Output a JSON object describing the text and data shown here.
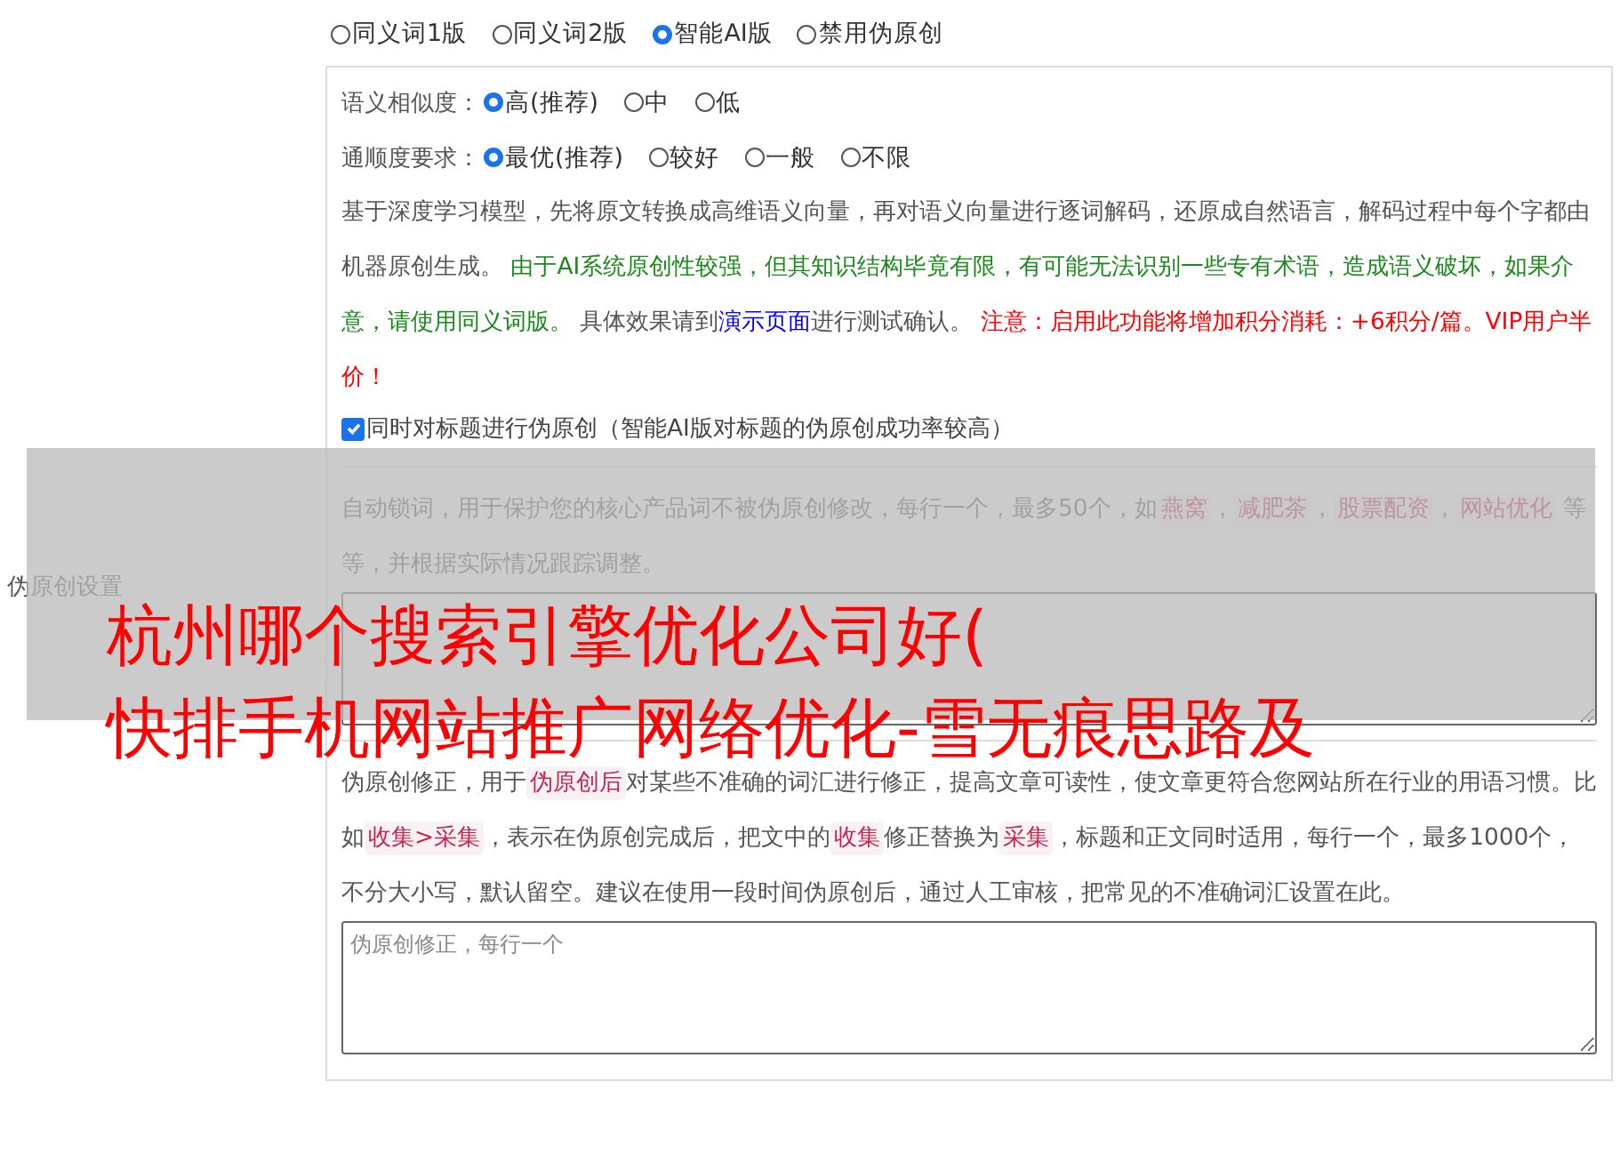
{
  "modes": [
    {
      "label": "同义词1版",
      "selected": false
    },
    {
      "label": "同义词2版",
      "selected": false
    },
    {
      "label": "智能AI版",
      "selected": true
    },
    {
      "label": "禁用伪原创",
      "selected": false
    }
  ],
  "side_label": "伪原创设置",
  "similarity": {
    "label": "语义相似度：",
    "options": [
      {
        "label": "高(推荐)",
        "selected": true
      },
      {
        "label": "中",
        "selected": false
      },
      {
        "label": "低",
        "selected": false
      }
    ]
  },
  "fluency": {
    "label": "通顺度要求：",
    "options": [
      {
        "label": "最优(推荐)",
        "selected": true
      },
      {
        "label": "较好",
        "selected": false
      },
      {
        "label": "一般",
        "selected": false
      },
      {
        "label": "不限",
        "selected": false
      }
    ]
  },
  "description": [
    {
      "kind": "plain",
      "text": "基于深度学习模型，先将原文转换成高维语义向量，再对语义向量进行逐词解码，还原成自然语言，解码过程中每个字都由机器原创生成。 "
    },
    {
      "kind": "green",
      "text": "由于AI系统原创性较强，但其知识结构毕竟有限，有可能无法识别一些专有术语，造成语义破坏，如果介意，请使用同义词版。"
    },
    {
      "kind": "plain",
      "text": " 具体效果请到"
    },
    {
      "kind": "link",
      "text": "演示页面"
    },
    {
      "kind": "plain",
      "text": "进行测试确认。 "
    },
    {
      "kind": "red",
      "text": "注意：启用此功能将增加积分消耗：+6积分/篇。VIP用户半价！"
    }
  ],
  "title_option": {
    "label": "同时对标题进行伪原创（智能AI版对标题的伪原创成功率较高）",
    "checked": true
  },
  "lock_words": {
    "description": [
      {
        "kind": "plain",
        "text": "自动锁词，用于保护您的核心产品词不被伪原创修改，每行一个，最多50个，如"
      },
      {
        "kind": "tag",
        "text": "燕窝"
      },
      {
        "kind": "plain",
        "text": "，"
      },
      {
        "kind": "tag",
        "text": "减肥茶"
      },
      {
        "kind": "plain",
        "text": "，"
      },
      {
        "kind": "tag",
        "text": "股票配资"
      },
      {
        "kind": "plain",
        "text": "，"
      },
      {
        "kind": "tag",
        "text": "网站优化"
      },
      {
        "kind": "plain",
        "text": " 等等，并根据实际情况跟踪调整。"
      }
    ]
  },
  "corrections": {
    "description": [
      {
        "kind": "plain",
        "text": "伪原创修正，用于"
      },
      {
        "kind": "tag",
        "text": "伪原创后"
      },
      {
        "kind": "plain",
        "text": "对某些不准确的词汇进行修正，提高文章可读性，使文章更符合您网站所在行业的用语习惯。比如"
      },
      {
        "kind": "tag",
        "text": "收集>采集"
      },
      {
        "kind": "plain",
        "text": "，表示在伪原创完成后，把文中的"
      },
      {
        "kind": "tag",
        "text": "收集"
      },
      {
        "kind": "plain",
        "text": "修正替换为"
      },
      {
        "kind": "tag",
        "text": "采集"
      },
      {
        "kind": "plain",
        "text": "，标题和正文同时适用，每行一个，最多1000个，不分大小写，默认留空。建议在使用一段时间伪原创后，通过人工审核，把常见的不准确词汇设置在此。"
      }
    ],
    "placeholder": "伪原创修正，每行一个"
  },
  "overlay_caption": [
    "杭州哪个搜索引擎优化公司好(",
    "快排手机网站推广网络优化-雪无痕思路及"
  ]
}
